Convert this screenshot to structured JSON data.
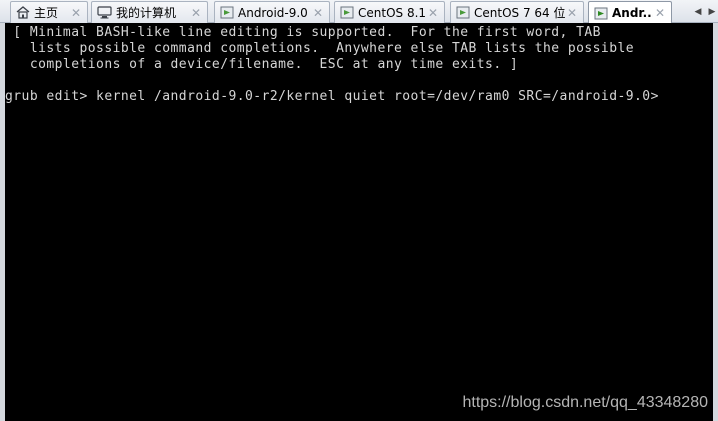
{
  "tabs": [
    {
      "label": "主页",
      "icon": "home-icon"
    },
    {
      "label": "我的计算机",
      "icon": "computer-icon"
    },
    {
      "label": "Android-9.0",
      "icon": "vm-icon"
    },
    {
      "label": "CentOS 8.1",
      "icon": "vm-icon"
    },
    {
      "label": "CentOS 7 64 位",
      "icon": "vm-icon"
    },
    {
      "label": "Andr...",
      "icon": "vm-running-icon",
      "active": true
    }
  ],
  "terminal": {
    "lines": [
      " [ Minimal BASH-like line editing is supported.  For the first word, TAB",
      "   lists possible command completions.  Anywhere else TAB lists the possible",
      "   completions of a device/filename.  ESC at any time exits. ]",
      "grub edit> kernel /android-9.0-r2/kernel quiet root=/dev/ram0 SRC=/android-9.0>"
    ]
  },
  "watermark": "https://blog.csdn.net/qq_43348280",
  "colors": {
    "terminal_bg": "#000000",
    "terminal_fg": "#d6d6d6",
    "vm_accent": "#4a9a3a"
  }
}
